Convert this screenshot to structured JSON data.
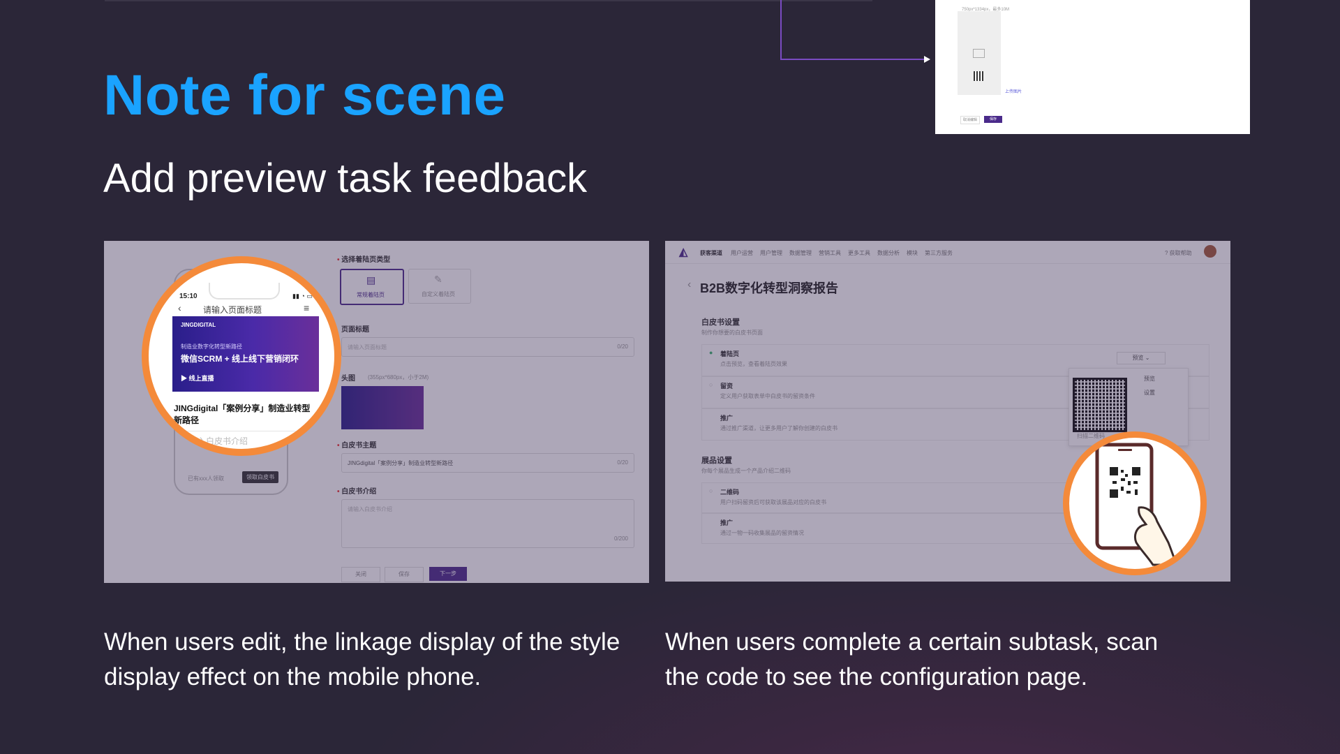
{
  "slide": {
    "heading": "Note for scene",
    "subheading": "Add preview task feedback",
    "caption_left": "When users edit, the linkage display of the style display effect on the mobile phone.",
    "caption_right": "When users complete a certain subtask, scan the code to see the configuration page."
  },
  "preview_card": {
    "hint": "750px*1334px，最多10M",
    "upload_link": "上传图片",
    "cancel": "取消编辑",
    "save": "保存"
  },
  "left_screen": {
    "section_type": "选择着陆页类型",
    "type_option_1": "常规着陆页",
    "type_option_2": "自定义着陆页",
    "page_title_label": "页面标题",
    "page_title_placeholder": "请输入页面标题",
    "page_title_count": "0/20",
    "header_image_label": "头图",
    "header_image_hint": "(355px*680px，小于2M)",
    "theme_label": "白皮书主题",
    "theme_value": "JINGdigital「案例分享」制造业转型新路径",
    "theme_count": "0/20",
    "intro_label": "白皮书介绍",
    "intro_placeholder": "请输入白皮书介绍",
    "intro_count": "0/200",
    "btn_close": "关闭",
    "btn_save": "保存",
    "btn_next": "下一步",
    "phone_footer_text": "已有xxx人领取",
    "phone_footer_button": "领取白皮书",
    "zoom": {
      "status_time": "15:10",
      "page_title": "请输入页面标题",
      "brand": "JINGDIGITAL",
      "banner_line1": "制造业数字化转型新路径",
      "banner_line2": "微信SCRM + 线上线下营销闭环",
      "banner_live": "线上直播",
      "article_title": "JINGdigital「案例分享」制造业转型新路径",
      "intro_placeholder": "请输入白皮书介绍"
    }
  },
  "right_screen": {
    "nav": [
      "获客渠道",
      "用户运营",
      "用户管理",
      "数据管理",
      "营销工具",
      "更多工具",
      "数据分析",
      "模块",
      "第三方服务"
    ],
    "help": "获取帮助",
    "page_title": "B2B数字化转型洞察报告",
    "whitepaper_settings": "白皮书设置",
    "whitepaper_sub": "制作你想要的白皮书页面",
    "item1_title": "着陆页",
    "item1_desc": "点击预览，查看着陆页效果",
    "item2_title": "留资",
    "item2_desc": "定义用户获取表单中白皮书的留资条件",
    "item3_title": "推广",
    "item3_desc": "通过推广渠道，让更多用户了解你创建的白皮书",
    "preview_button": "预览",
    "menu_preview": "预览",
    "menu_settings": "设置",
    "scan_hint": "扫描二维码",
    "exhibit_settings": "展品设置",
    "exhibit_sub": "你每个展品生成一个产品介绍二维码",
    "item4_title": "二维码",
    "item4_desc": "用户扫码留资后可获取该展品对应的白皮书",
    "item5_title": "推广",
    "item5_desc": "通过一物一码收集展品的留资情况"
  },
  "colors": {
    "heading": "#1aa3ff",
    "accent_orange": "#f48a3a",
    "brand_purple": "#4a2a8a"
  }
}
